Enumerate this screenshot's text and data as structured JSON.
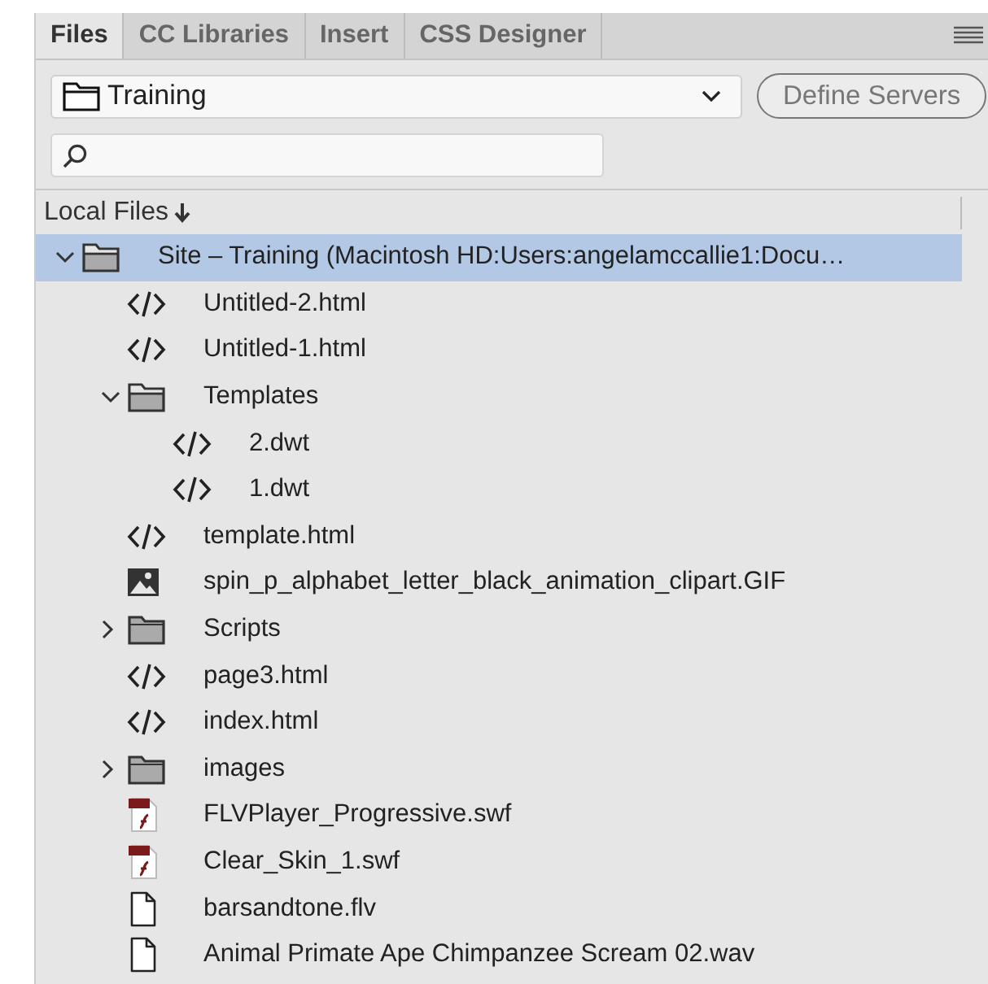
{
  "tabs": [
    {
      "label": "Files",
      "selected": true
    },
    {
      "label": "CC Libraries",
      "selected": false
    },
    {
      "label": "Insert",
      "selected": false
    },
    {
      "label": "CSS Designer",
      "selected": false
    }
  ],
  "site_picker": {
    "value": "Training"
  },
  "define_servers_button": {
    "label": "Define Servers"
  },
  "header": {
    "label": "Local Files"
  },
  "tree": [
    {
      "kind": "folder",
      "label": "Site – Training (Macintosh HD:Users:angelamccallie1:Docu…",
      "expanded": true,
      "selected": true,
      "children": [
        {
          "kind": "code",
          "label": "Untitled-2.html",
          "selected": false
        },
        {
          "kind": "code",
          "label": "Untitled-1.html",
          "selected": false
        },
        {
          "kind": "folder",
          "label": "Templates",
          "expanded": true,
          "selected": false,
          "children": [
            {
              "kind": "code",
              "label": "2.dwt",
              "selected": false
            },
            {
              "kind": "code",
              "label": "1.dwt",
              "selected": false
            }
          ]
        },
        {
          "kind": "code",
          "label": "template.html",
          "selected": false
        },
        {
          "kind": "image",
          "label": "spin_p_alphabet_letter_black_animation_clipart.GIF",
          "selected": false
        },
        {
          "kind": "folder",
          "label": "Scripts",
          "expanded": false,
          "selected": false
        },
        {
          "kind": "code",
          "label": "page3.html",
          "selected": false
        },
        {
          "kind": "code",
          "label": "index.html",
          "selected": false
        },
        {
          "kind": "folder",
          "label": "images",
          "expanded": false,
          "selected": false
        },
        {
          "kind": "swf",
          "label": "FLVPlayer_Progressive.swf",
          "selected": false
        },
        {
          "kind": "swf",
          "label": "Clear_Skin_1.swf",
          "selected": false
        },
        {
          "kind": "file",
          "label": "barsandtone.flv",
          "selected": false
        },
        {
          "kind": "file",
          "label": "Animal Primate Ape Chimpanzee Scream 02.wav",
          "selected": false
        }
      ]
    }
  ]
}
